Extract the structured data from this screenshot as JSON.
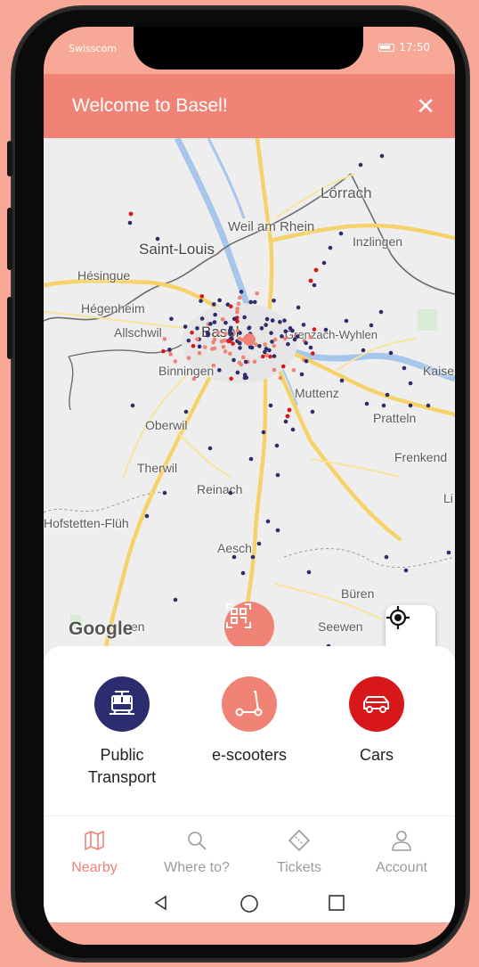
{
  "status_bar": {
    "carrier": "Swisscom",
    "time": "17:50"
  },
  "header": {
    "title": "Welcome to Basel!",
    "close_icon": "close-icon"
  },
  "map": {
    "labels": {
      "loerrach": "Lörrach",
      "weil": "Weil am Rhein",
      "inzlingen": "Inzlingen",
      "saint_louis": "Saint-Louis",
      "hesingue": "Hésingue",
      "hegenheim": "Hégenheim",
      "allschwil": "Allschwil",
      "basel": "Basel",
      "grenzach": "Grenzach-Wyhlen",
      "binningen": "Binningen",
      "muttenz": "Muttenz",
      "kaiseraugst": "Kaise",
      "pratteln": "Pratteln",
      "oberwil": "Oberwil",
      "frenkendorf": "Frenkend",
      "therwil": "Therwil",
      "reinach": "Reinach",
      "hofstetten": "Hofstetten-Flüh",
      "aesch": "Aesch",
      "bueren": "Büren",
      "seewen": "Seewen",
      "lo": "Li",
      "en": "en"
    },
    "attribution": "Google",
    "qr_icon": "qr-scan-icon",
    "locate_icon": "locate-icon",
    "colors": {
      "tram_stop": "#2b2d6e",
      "scooter": "#f08376",
      "car": "#d8171a"
    }
  },
  "modes": [
    {
      "label": "Public Transport",
      "line1": "Public",
      "line2": "Transport",
      "icon": "tram-icon",
      "color": "#2b2d6e"
    },
    {
      "label": "e-scooters",
      "icon": "scooter-icon",
      "color": "#f08376"
    },
    {
      "label": "Cars",
      "icon": "car-icon",
      "color": "#d8171a"
    }
  ],
  "tabs": [
    {
      "label": "Nearby",
      "icon": "map-icon",
      "active": true
    },
    {
      "label": "Where to?",
      "icon": "search-icon",
      "active": false
    },
    {
      "label": "Tickets",
      "icon": "ticket-icon",
      "active": false
    },
    {
      "label": "Account",
      "icon": "account-icon",
      "active": false
    }
  ],
  "accent": "#f08376"
}
